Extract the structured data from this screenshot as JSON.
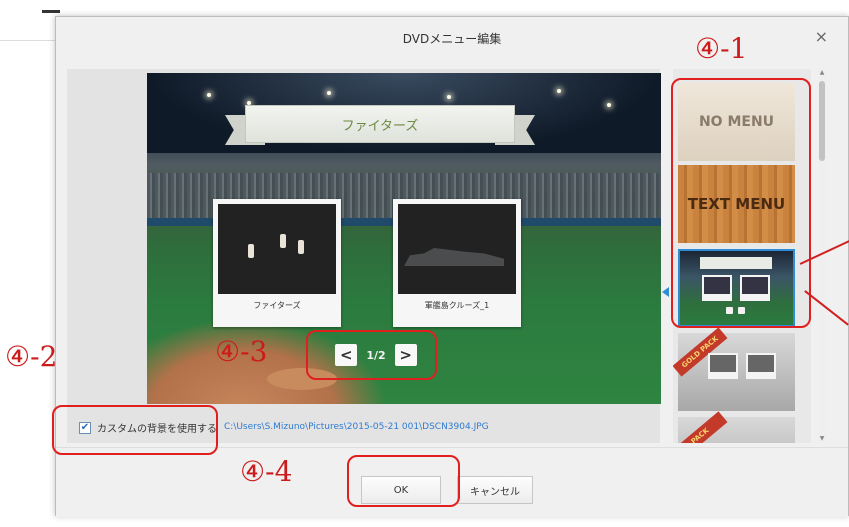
{
  "dialog": {
    "title": "DVDメニュー編集",
    "close_glyph": "×"
  },
  "preview": {
    "menu_title": "ファイターズ",
    "thumbnails": [
      {
        "caption": "ファイターズ"
      },
      {
        "caption": "軍艦島クルーズ_1"
      }
    ],
    "prev_glyph": "<",
    "next_glyph": ">",
    "page_indicator": "1/2"
  },
  "custom_background": {
    "checked": true,
    "check_glyph": "✔",
    "label": "カスタムの背景を使用する",
    "path": "C:\\Users\\S.Mizuno\\Pictures\\2015-05-21 001\\DSCN3904.JPG"
  },
  "menu_templates": [
    {
      "label": "NO MENU"
    },
    {
      "label": "TEXT MENU"
    },
    {
      "label": ""
    },
    {
      "label": "",
      "tag": "GOLD PACK"
    },
    {
      "label": "",
      "tag": "PACK"
    }
  ],
  "scrollbar": {
    "up_glyph": "▲",
    "down_glyph": "▼"
  },
  "footer": {
    "ok_label": "OK",
    "cancel_label": "キャンセル"
  },
  "annotations": {
    "a1": "④-1",
    "a2": "④-2",
    "a3": "④-3",
    "a4": "④-4",
    "color": "#e01f1f"
  }
}
